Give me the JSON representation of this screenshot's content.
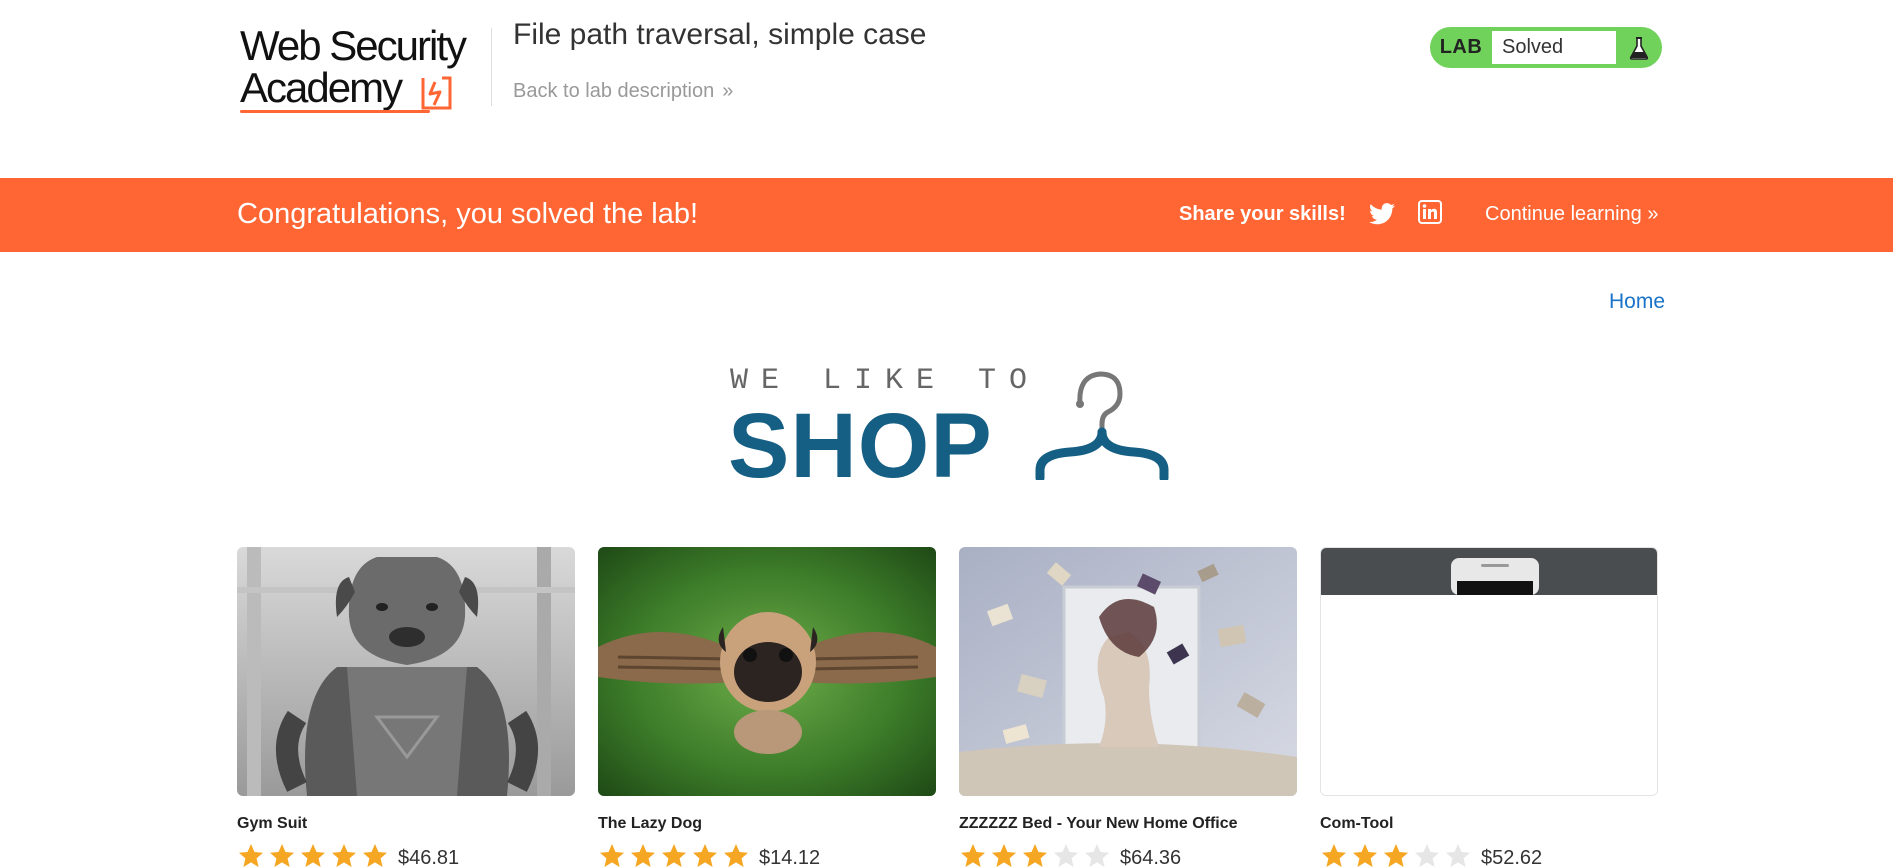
{
  "header": {
    "logo": {
      "line1": "Web Security",
      "line2": "Academy"
    },
    "lab_title": "File path traversal, simple case",
    "back_link": "Back to lab description",
    "back_chevron": "»",
    "lab_status": {
      "badge": "LAB",
      "status": "Solved",
      "icon": "flask-icon"
    }
  },
  "banner": {
    "message": "Congratulations, you solved the lab!",
    "share_label": "Share your skills!",
    "twitter_icon": "twitter-icon",
    "linkedin_icon": "linkedin-icon",
    "continue_label": "Continue learning",
    "continue_chevron": "»"
  },
  "nav": {
    "home": "Home"
  },
  "shop_logo": {
    "tagline": "WE LIKE TO",
    "word": "SHOP",
    "icon": "hanger-icon"
  },
  "colors": {
    "orange": "#ff6633",
    "green": "#70d25a",
    "blue": "#155e84",
    "link": "#1a73c8",
    "star": "#f5a623",
    "star_empty": "#e6e6e6"
  },
  "products": [
    {
      "name": "Gym Suit",
      "rating": 5,
      "price": "$46.81",
      "image": "muscular-dog-photo"
    },
    {
      "name": "The Lazy Dog",
      "rating": 5,
      "price": "$14.12",
      "image": "flying-pug-photo"
    },
    {
      "name": "ZZZZZZ Bed - Your New Home Office",
      "rating": 3,
      "price": "$64.36",
      "image": "flying-books-photo"
    },
    {
      "name": "Com-Tool",
      "rating": 3,
      "price": "$52.62",
      "image": "phone-photo"
    }
  ]
}
